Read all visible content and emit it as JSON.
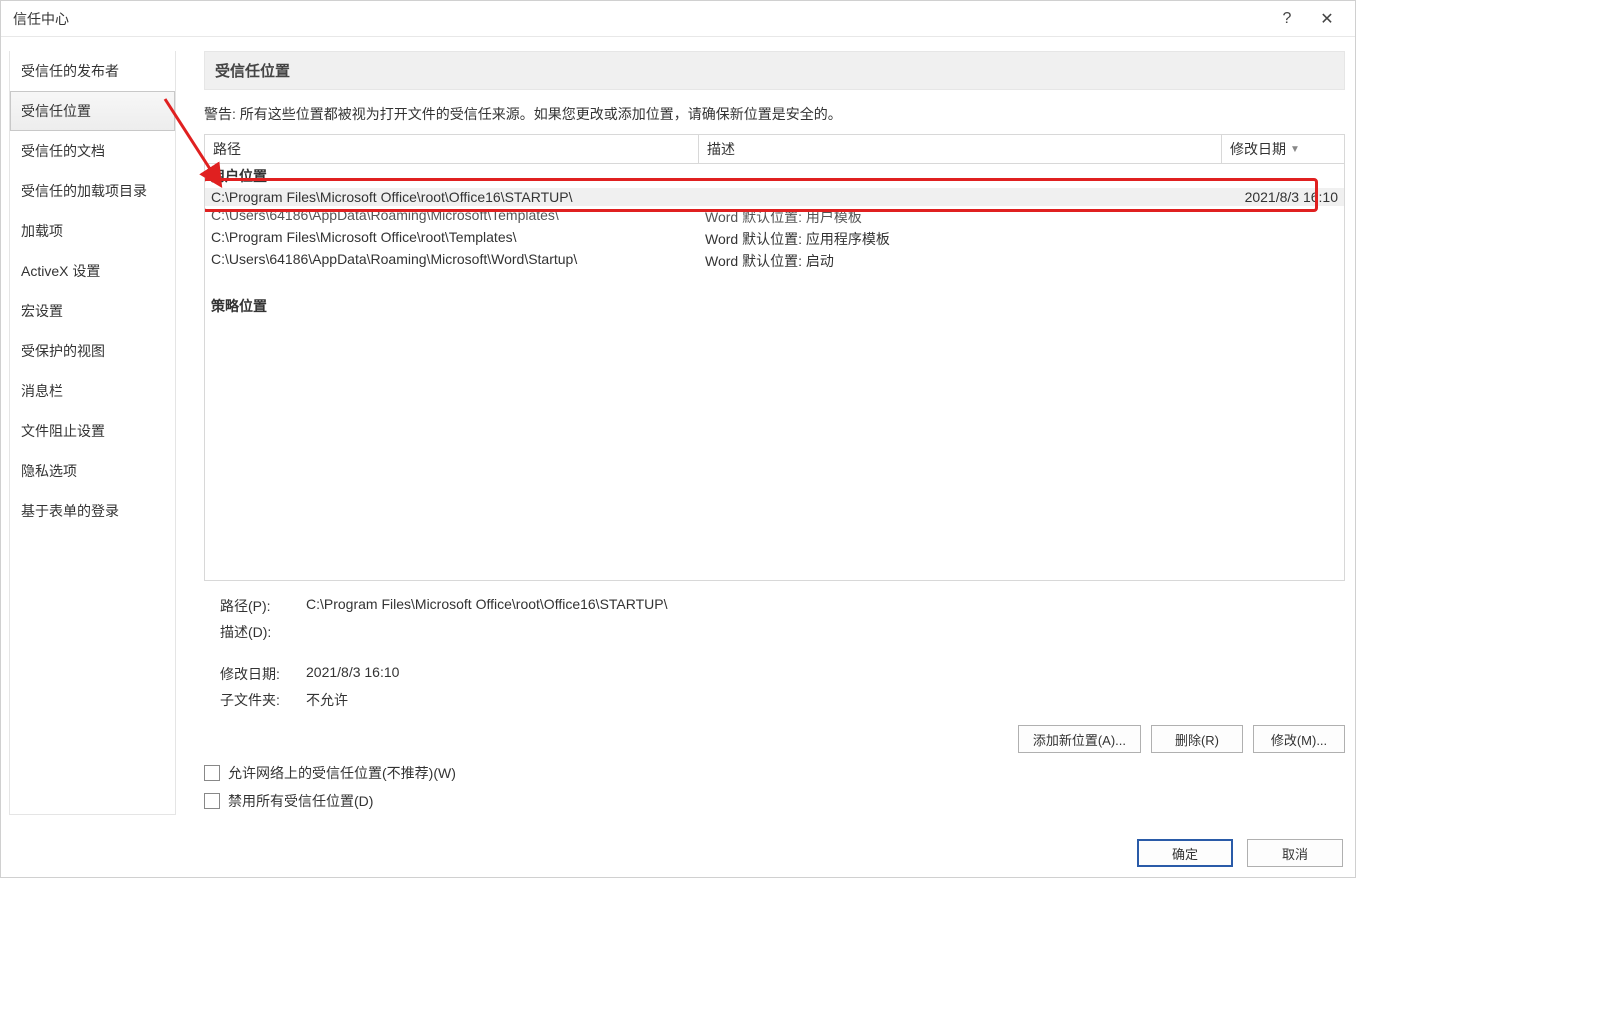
{
  "dialog": {
    "title": "信任中心",
    "help_tooltip": "?",
    "close_tooltip": "✕"
  },
  "sidebar": {
    "items": [
      {
        "label": "受信任的发布者"
      },
      {
        "label": "受信任位置"
      },
      {
        "label": "受信任的文档"
      },
      {
        "label": "受信任的加载项目录"
      },
      {
        "label": "加载项"
      },
      {
        "label": "ActiveX 设置"
      },
      {
        "label": "宏设置"
      },
      {
        "label": "受保护的视图"
      },
      {
        "label": "消息栏"
      },
      {
        "label": "文件阻止设置"
      },
      {
        "label": "隐私选项"
      },
      {
        "label": "基于表单的登录"
      }
    ],
    "selected_index": 1
  },
  "section": {
    "heading": "受信任位置",
    "warning": "警告: 所有这些位置都被视为打开文件的受信任来源。如果您更改或添加位置，请确保新位置是安全的。"
  },
  "table": {
    "columns": {
      "path": "路径",
      "desc": "描述",
      "date": "修改日期"
    },
    "groups": {
      "user": "用户位置",
      "policy": "策略位置"
    },
    "rows": [
      {
        "path": "C:\\Program Files\\Microsoft Office\\root\\Office16\\STARTUP\\",
        "desc": "",
        "date": "2021/8/3 16:10",
        "selected": true
      },
      {
        "path": "C:\\Users\\64186\\AppData\\Roaming\\Microsoft\\Templates\\",
        "desc": "Word 默认位置: 用户模板",
        "date": ""
      },
      {
        "path": "C:\\Program Files\\Microsoft Office\\root\\Templates\\",
        "desc": "Word 默认位置: 应用程序模板",
        "date": ""
      },
      {
        "path": "C:\\Users\\64186\\AppData\\Roaming\\Microsoft\\Word\\Startup\\",
        "desc": "Word 默认位置: 启动",
        "date": ""
      }
    ]
  },
  "details": {
    "labels": {
      "path": "路径(P):",
      "desc": "描述(D):",
      "date": "修改日期:",
      "sub": "子文件夹:"
    },
    "values": {
      "path": "C:\\Program Files\\Microsoft Office\\root\\Office16\\STARTUP\\",
      "desc": "",
      "date": "2021/8/3 16:10",
      "sub": "不允许"
    }
  },
  "buttons": {
    "add": "添加新位置(A)...",
    "remove": "删除(R)",
    "modify": "修改(M)...",
    "ok": "确定",
    "cancel": "取消"
  },
  "checkboxes": {
    "allow_network": "允许网络上的受信任位置(不推荐)(W)",
    "disable_all": "禁用所有受信任位置(D)"
  }
}
